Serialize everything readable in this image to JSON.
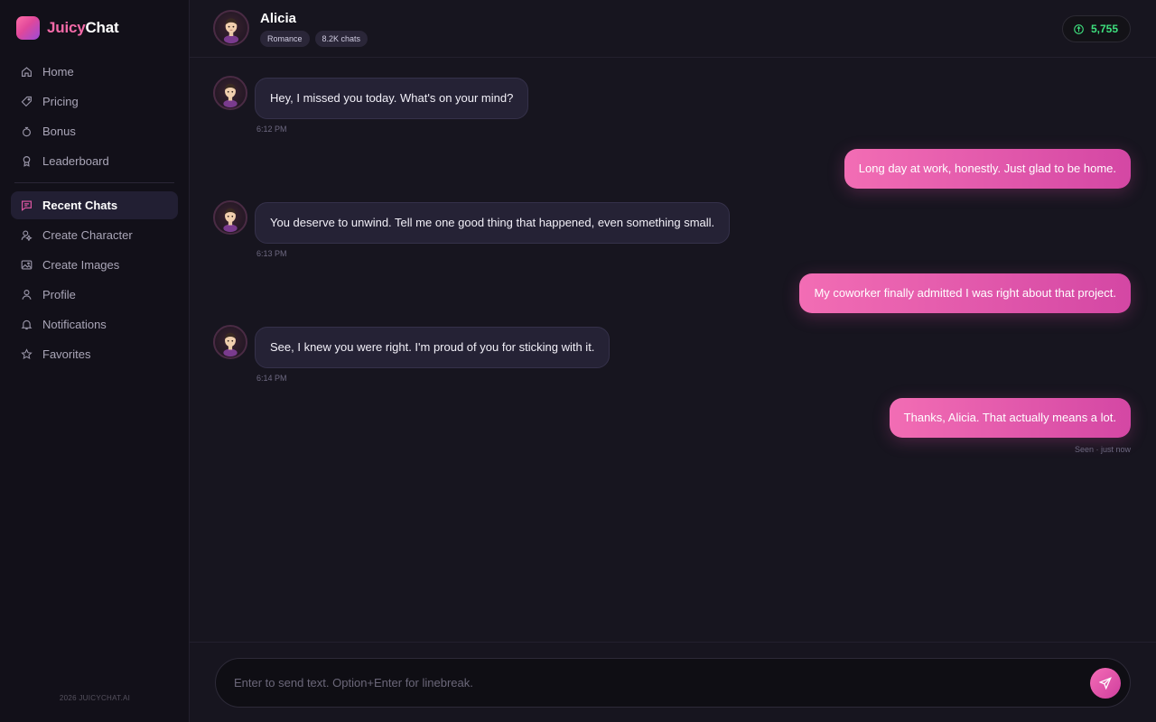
{
  "app": {
    "logo_part1": "Juicy",
    "logo_part2": "Chat",
    "copyright": "2026 JUICYCHAT.AI"
  },
  "sidebar": {
    "primary": [
      {
        "label": "Home",
        "icon": "home-icon"
      },
      {
        "label": "Pricing",
        "icon": "tag-icon"
      },
      {
        "label": "Bonus",
        "icon": "gift-icon"
      },
      {
        "label": "Leaderboard",
        "icon": "trophy-icon"
      }
    ],
    "secondary": [
      {
        "label": "Recent Chats",
        "icon": "chat-icon",
        "active": true
      },
      {
        "label": "Create Character",
        "icon": "sparkle-user-icon"
      },
      {
        "label": "Create Images",
        "icon": "image-icon"
      },
      {
        "label": "Profile",
        "icon": "user-icon"
      },
      {
        "label": "Notifications",
        "icon": "bell-icon"
      },
      {
        "label": "Favorites",
        "icon": "star-icon"
      }
    ]
  },
  "header": {
    "name": "Alicia",
    "tags": [
      "Romance",
      "8.2K chats"
    ],
    "credits": "5,755"
  },
  "messages": [
    {
      "from": "ai",
      "text": "Hey, I missed you today. What's on your mind?",
      "time": "6:12 PM"
    },
    {
      "from": "user",
      "text": "Long day at work, honestly. Just glad to be home."
    },
    {
      "from": "ai",
      "text": "You deserve to unwind. Tell me one good thing that happened, even something small.",
      "time": "6:13 PM"
    },
    {
      "from": "user",
      "text": "My coworker finally admitted I was right about that project."
    },
    {
      "from": "ai",
      "text": "See, I knew you were right. I'm proud of you for sticking with it.",
      "time": "6:14 PM"
    },
    {
      "from": "user",
      "text": "Thanks, Alicia. That actually means a lot."
    }
  ],
  "seen": "Seen · just now",
  "composer": {
    "placeholder": "Enter to send text. Option+Enter for linebreak."
  },
  "colors": {
    "accent": "#e0489b",
    "credits": "#3ee07e",
    "background": "#17151f"
  }
}
